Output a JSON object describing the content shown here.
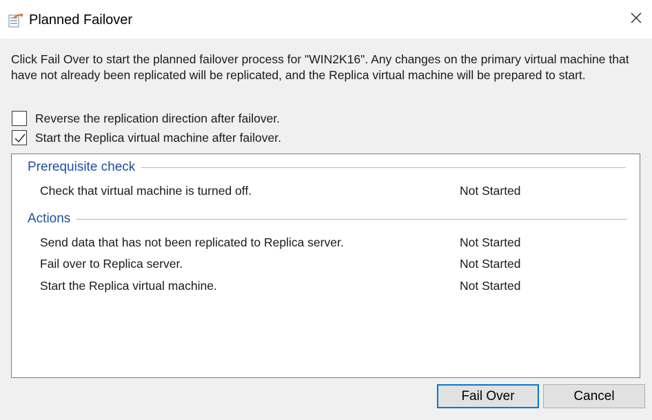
{
  "window": {
    "title": "Planned Failover",
    "icon": "failover-wizard-icon",
    "close_icon": "close-icon"
  },
  "description": "Click Fail Over to start the planned failover process for \"WIN2K16\". Any changes on the primary virtual machine that have not already been replicated will be replicated, and the Replica virtual machine will be prepared to start.",
  "options": [
    {
      "label": "Reverse the replication direction after failover.",
      "checked": false
    },
    {
      "label": "Start the Replica virtual machine after failover.",
      "checked": true
    }
  ],
  "sections": [
    {
      "title": "Prerequisite check",
      "tasks": [
        {
          "label": "Check that virtual machine is turned off.",
          "status": "Not Started"
        }
      ]
    },
    {
      "title": "Actions",
      "tasks": [
        {
          "label": "Send data that has not been replicated to Replica server.",
          "status": "Not Started"
        },
        {
          "label": "Fail over to Replica server.",
          "status": "Not Started"
        },
        {
          "label": "Start the Replica virtual machine.",
          "status": "Not Started"
        }
      ]
    }
  ],
  "buttons": {
    "fail_over": "Fail Over",
    "cancel": "Cancel"
  },
  "colors": {
    "section_title": "#1e4fa0",
    "primary_button_border": "#0078d7"
  }
}
